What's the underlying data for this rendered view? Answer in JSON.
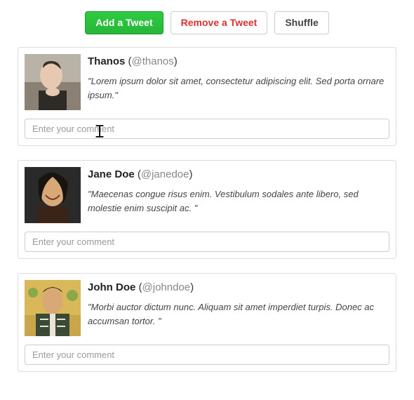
{
  "buttons": {
    "add": "Add a Tweet",
    "remove": "Remove a Tweet",
    "shuffle": "Shuffle"
  },
  "comment_placeholder": "Enter your comment",
  "tweets": [
    {
      "name": "Thanos",
      "handle": "@thanos",
      "text": "\"Lorem ipsum dolor sit amet, consectetur adipiscing elit. Sed porta ornare ipsum.\""
    },
    {
      "name": "Jane Doe",
      "handle": "@janedoe",
      "text": "\"Maecenas congue risus enim. Vestibulum sodales ante libero, sed molestie enim suscipit ac. \""
    },
    {
      "name": "John Doe",
      "handle": "@johndoe",
      "text": "\"Morbi auctor dictum nunc. Aliquam sit amet imperdiet turpis. Donec ac accumsan tortor. \""
    }
  ]
}
